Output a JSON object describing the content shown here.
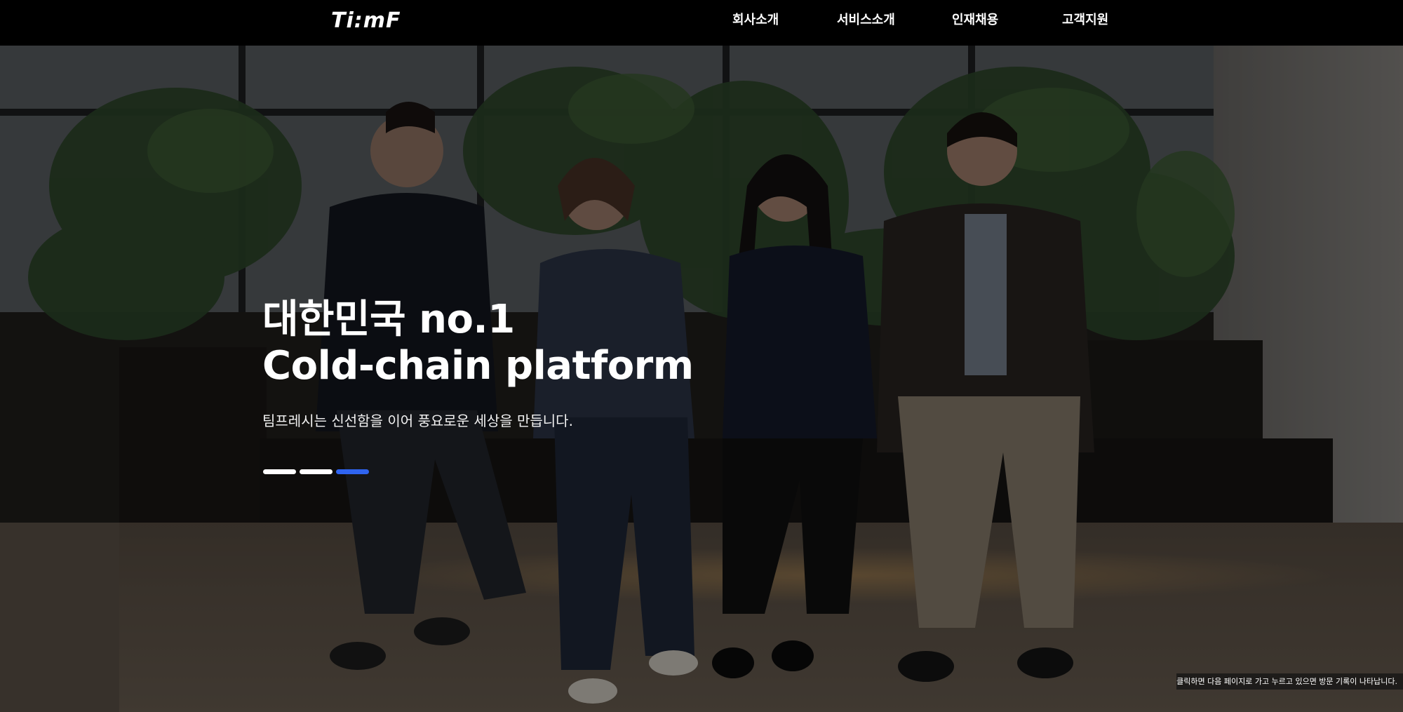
{
  "header": {
    "logo_text": "Ti:mF",
    "nav": [
      {
        "label": "회사소개"
      },
      {
        "label": "서비스소개"
      },
      {
        "label": "인재채용"
      },
      {
        "label": "고객지원"
      }
    ]
  },
  "hero": {
    "title_line1": "대한민국 no.1",
    "title_line2": "Cold-chain platform",
    "subtitle": "팀프레시는 신선함을 이어 풍요로운 세상을 만듭니다.",
    "image_icon": "office-people-photo",
    "slides": {
      "count": 3,
      "active_index": 2
    },
    "colors": {
      "pager_active": "#2f64f0",
      "pager_inactive": "#ffffff"
    }
  },
  "tooltip": {
    "text": "클릭하면 다음 페이지로 가고 누르고 있으면 방문 기록이 나타납니다."
  }
}
